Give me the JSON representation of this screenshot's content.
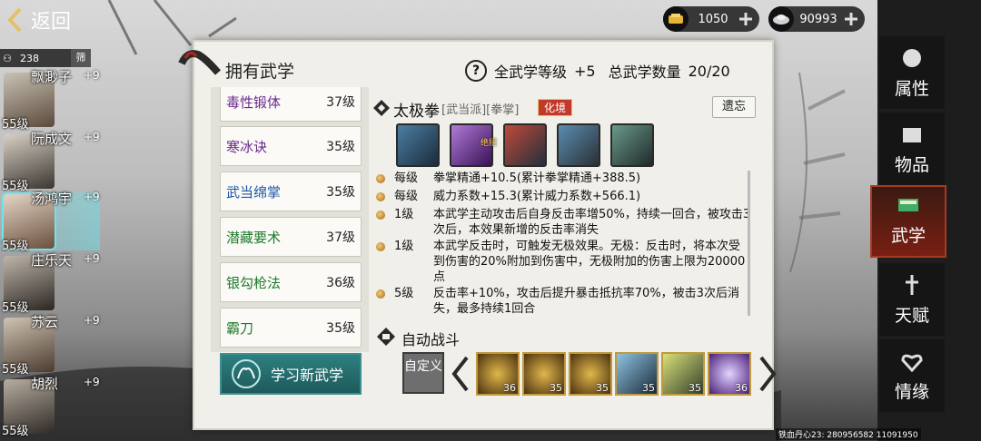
{
  "header": {
    "back_label": "返回",
    "gold": "1050",
    "silver": "90993"
  },
  "char_list": {
    "count": "238",
    "filter_label": "筛",
    "characters": [
      {
        "name": "飘渺子",
        "bonus": "+9",
        "level": "55级"
      },
      {
        "name": "阮成文",
        "bonus": "+9",
        "level": "55级"
      },
      {
        "name": "汤鸿宇",
        "bonus": "+9",
        "level": "55级"
      },
      {
        "name": "庄乐天",
        "bonus": "+9",
        "level": "55级"
      },
      {
        "name": "苏云",
        "bonus": "+9",
        "level": "55级"
      },
      {
        "name": "胡烈",
        "bonus": "+9",
        "level": "55级"
      }
    ]
  },
  "panel": {
    "title": "拥有武学",
    "all_level_label": "全武学等级",
    "all_level_value": "+5",
    "total_label": "总武学数量",
    "total_value": "20/20"
  },
  "skills": [
    {
      "name": "毒性锻体",
      "level": "37级",
      "color": "#6a2a8f"
    },
    {
      "name": "寒冰诀",
      "level": "35级",
      "color": "#6a2a8f"
    },
    {
      "name": "武当绵掌",
      "level": "35级",
      "color": "#1f55a8"
    },
    {
      "name": "潜藏要术",
      "level": "37级",
      "color": "#1d7a2c"
    },
    {
      "name": "银勾枪法",
      "level": "36级",
      "color": "#1d7a2c"
    },
    {
      "name": "霸刀",
      "level": "35级",
      "color": "#1d7a2c"
    }
  ],
  "learn_button": "学习新武学",
  "detail": {
    "name": "太极拳",
    "tags": "[武当派][拳掌]",
    "realm": "化境",
    "forget": "遗忘",
    "ultimate_badge": "绝招",
    "effects": [
      {
        "level": "每级",
        "text": "拳掌精通+10.5(累计拳掌精通+388.5)"
      },
      {
        "level": "每级",
        "text": "威力系数+15.3(累计威力系数+566.1)"
      },
      {
        "level": "1级",
        "text": "本武学主动攻击后自身反击率增50%，持续一回合，被攻击3次后，本效果新增的反击率消失"
      },
      {
        "level": "1级",
        "text": "本武学反击时，可触发无极效果。无极：反击时，将本次受到伤害的20%附加到伤害中，无极附加的伤害上限为20000点"
      },
      {
        "level": "5级",
        "text": "反击率+10%，攻击后提升暴击抵抗率70%，被击3次后消失，最多持续1回合"
      }
    ]
  },
  "auto_battle": {
    "label": "自动战斗",
    "custom_label": "自定义",
    "slots": [
      "36",
      "35",
      "35",
      "35",
      "35",
      "36"
    ]
  },
  "tabs": [
    {
      "label": "属性",
      "icon": "fist-icon"
    },
    {
      "label": "物品",
      "icon": "box-icon"
    },
    {
      "label": "武学",
      "icon": "book-icon"
    },
    {
      "label": "天赋",
      "icon": "flower-icon"
    },
    {
      "label": "情缘",
      "icon": "heart-icon"
    }
  ],
  "footer": "铁血丹心23: 280956582 11091950"
}
